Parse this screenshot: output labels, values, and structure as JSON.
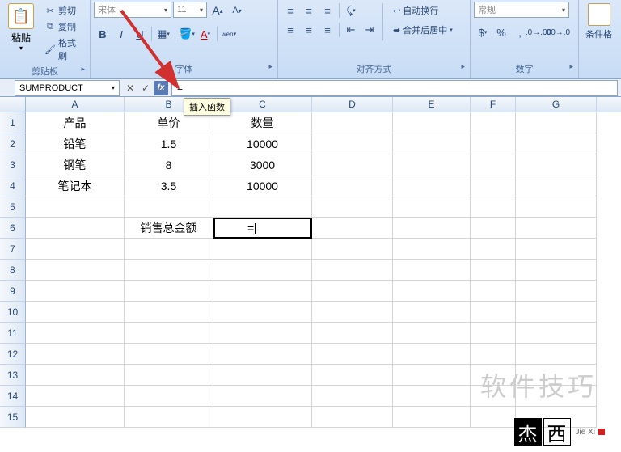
{
  "ribbon": {
    "clipboard": {
      "label": "剪贴板",
      "paste": "粘贴",
      "cut": "剪切",
      "copy": "复制",
      "painter": "格式刷"
    },
    "font": {
      "label": "字体",
      "name": "宋体",
      "size": "11",
      "grow": "A",
      "shrink": "A",
      "bold": "B",
      "italic": "I",
      "underline": "U"
    },
    "align": {
      "label": "对齐方式",
      "wrap": "自动换行",
      "merge": "合并后居中"
    },
    "number": {
      "label": "数字",
      "general": "常规"
    },
    "styles": {
      "cond": "条件格"
    }
  },
  "fbar": {
    "name": "SUMPRODUCT",
    "formula": "=",
    "tooltip": "插入函数"
  },
  "cols": [
    "A",
    "B",
    "C",
    "D",
    "E",
    "F",
    "G"
  ],
  "rownums": [
    "1",
    "2",
    "3",
    "4",
    "5",
    "6",
    "7",
    "8",
    "9",
    "10",
    "11",
    "12",
    "13",
    "14",
    "15"
  ],
  "cells": {
    "A1": "产品",
    "B1": "单价",
    "C1": "数量",
    "A2": "铅笔",
    "B2": "1.5",
    "C2": "10000",
    "A3": "钢笔",
    "B3": "8",
    "C3": "3000",
    "A4": "笔记本",
    "B4": "3.5",
    "C4": "10000",
    "B6": "销售总金额",
    "C6": "="
  },
  "active": "C6",
  "wm": {
    "text1": "软件技巧",
    "j": "杰",
    "x": "西",
    "py": "Jie Xi"
  }
}
